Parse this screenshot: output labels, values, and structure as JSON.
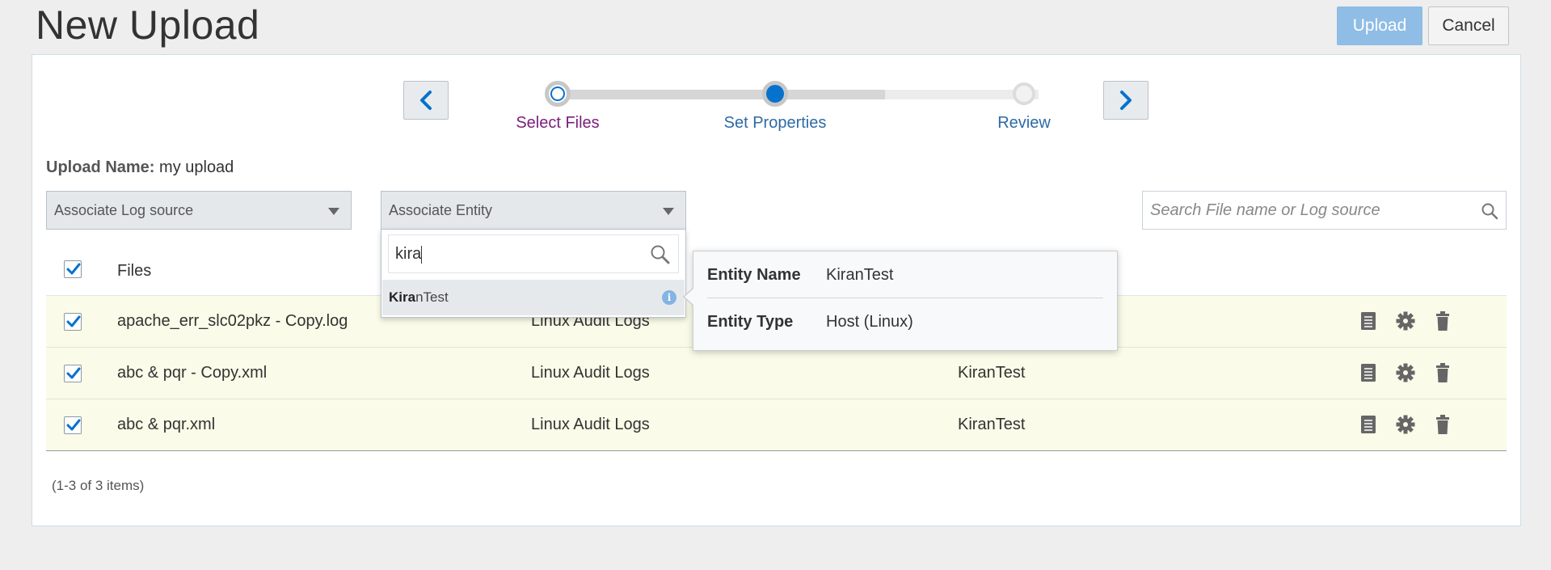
{
  "header": {
    "title": "New Upload",
    "upload_label": "Upload",
    "cancel_label": "Cancel"
  },
  "train": {
    "steps": [
      {
        "label": "Select Files",
        "state": "visited"
      },
      {
        "label": "Set Properties",
        "state": "current"
      },
      {
        "label": "Review",
        "state": "unvisited"
      }
    ]
  },
  "form": {
    "upload_name_label": "Upload Name:",
    "upload_name_value": "my upload",
    "log_source_select": "Associate Log source",
    "entity_select": "Associate Entity",
    "search_placeholder": "Search File name or Log source"
  },
  "entity_dropdown": {
    "query": "kira",
    "option_match": "Kira",
    "option_rest": "nTest",
    "info_icon": "i"
  },
  "entity_popover": {
    "name_label": "Entity Name",
    "name_value": "KiranTest",
    "type_label": "Entity Type",
    "type_value": "Host (Linux)"
  },
  "table": {
    "header_files": "Files",
    "rows": [
      {
        "file": "apache_err_slc02pkz - Copy.log",
        "log_source": "Linux Audit Logs",
        "entity": ""
      },
      {
        "file": "abc & pqr - Copy.xml",
        "log_source": "Linux Audit Logs",
        "entity": "KiranTest"
      },
      {
        "file": "abc & pqr.xml",
        "log_source": "Linux Audit Logs",
        "entity": "KiranTest"
      }
    ],
    "footer": "(1-3 of 3 items)"
  },
  "colors": {
    "accent": "#0572ce",
    "upload_button": "#8fbde5",
    "row_background": "#fafbe8",
    "visited_step": "#7b1e7a"
  },
  "icons": [
    "chevron-left-icon",
    "chevron-right-icon",
    "search-icon",
    "checkbox-checked-icon",
    "details-icon",
    "gear-icon",
    "trash-icon",
    "info-icon"
  ]
}
